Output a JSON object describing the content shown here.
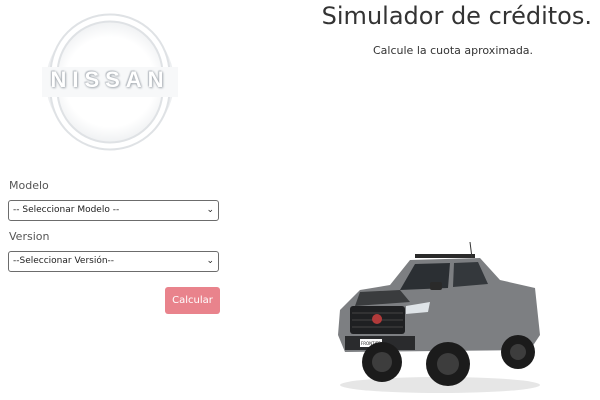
{
  "brand": {
    "logo_text": "NISSAN"
  },
  "header": {
    "title": "Simulador de créditos.",
    "subtitle": "Calcule la cuota aproximada."
  },
  "form": {
    "model_label": "Modelo",
    "model_selected": "-- Seleccionar Modelo --",
    "version_label": "Version",
    "version_selected": "--Seleccionar Versión--",
    "submit_label": "Calcular",
    "submit_color": "#e9838c"
  },
  "vehicle": {
    "plate_text": "FRONTIER"
  }
}
